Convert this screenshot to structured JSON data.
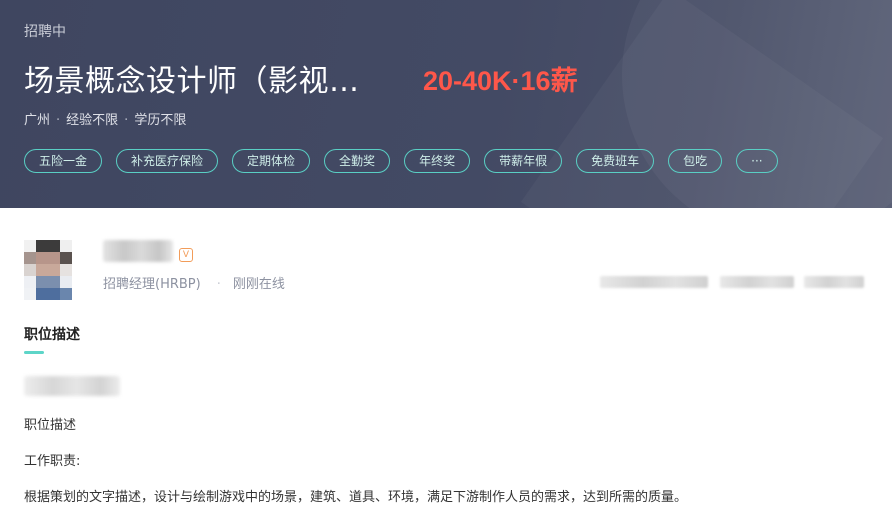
{
  "job": {
    "status": "招聘中",
    "title": "场景概念设计师（影视…",
    "salary": "20-40K·16薪",
    "location": "广州",
    "experience": "经验不限",
    "education": "学历不限",
    "benefits": [
      "五险一金",
      "补充医疗保险",
      "定期体检",
      "全勤奖",
      "年终奖",
      "带薪年假",
      "免费班车",
      "包吃",
      "···"
    ]
  },
  "recruiter": {
    "badge": "V",
    "role": "招聘经理(HRBP)",
    "online": "刚刚在线"
  },
  "description": {
    "heading": "职位描述",
    "label": "职位描述",
    "duties_heading": "工作职责:",
    "duty_1": "根据策划的文字描述，设计与绘制游戏中的场景，建筑、道具、环境，满足下游制作人员的需求，达到所需的质量。"
  },
  "colors": {
    "header_bg": "#434a64",
    "salary": "#fe574a",
    "tag_border": "#59cfc4",
    "accent": "#5dd5c8"
  }
}
